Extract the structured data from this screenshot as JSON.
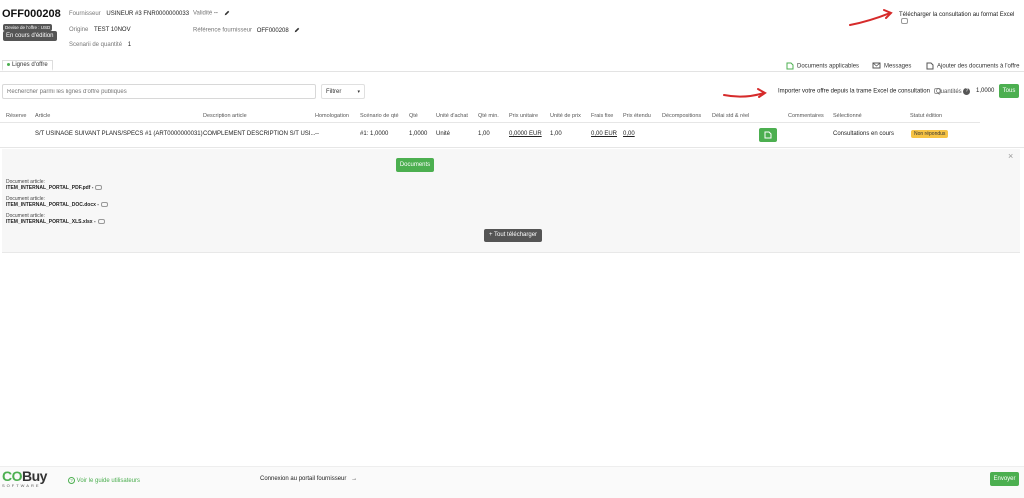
{
  "header": {
    "offer_id": "OFF000208",
    "currency_tag": "Devise de l'offre : USD",
    "status_tag": "En cours d'édition",
    "supplier_label": "Fournisseur",
    "supplier_value": "USINEUR #3 FNR0000000033",
    "origin_label": "Origine",
    "origin_value": "TEST 10NOV",
    "scenario_label": "Scenarii de quantité",
    "scenario_value": "1",
    "validity_label": "Validité",
    "validity_value": "--",
    "supplier_ref_label": "Référence fournisseur",
    "supplier_ref_value": "OFF000208",
    "download_excel": "Télécharger la consultation au format Excel"
  },
  "tabs": {
    "offer_lines": "Lignes d'offre"
  },
  "toolbar": {
    "applicable_docs": "Documents applicables",
    "messages": "Messages",
    "add_docs": "Ajouter des documents à l'offre",
    "search_placeholder": "Rechercher parmi les lignes d'offre publiques",
    "filter_label": "Filtrer",
    "import_excel": "Importer votre offre depuis la trame Excel de consultation",
    "quantities_label": "Quantités",
    "quantities_value": "1,0000",
    "all_button": "Tous"
  },
  "table": {
    "columns": [
      "Réserve",
      "Article",
      "Description article",
      "Homologation",
      "Scénario de qté",
      "Qté",
      "Unité d'achat",
      "Qté min.",
      "Prix unitaire",
      "Unité de prix",
      "Frais fixe",
      "Prix étendu",
      "Décompositions",
      "Délai std & réel",
      "Commentaires",
      "Sélectionné",
      "Statut édition"
    ],
    "row": {
      "article": "S/T USINAGE SUIVANT PLANS/SPECS #1 (ART0000000031)",
      "description": "COMPLEMENT DESCRIPTION S/T USI...",
      "homologation": "--",
      "scenario": "#1: 1,0000",
      "qty": "1,0000",
      "unit": "Unité",
      "min_qty": "1,00",
      "unit_price": "0,0000 EUR",
      "price_unit": "1,00",
      "fixed_fee": "0,00 EUR",
      "extended_price": "0,00",
      "selected": "Consultations en cours",
      "status": "Non répondus"
    }
  },
  "details": {
    "documents_button": "Documents",
    "doc_label": "Document article:",
    "docs": [
      "ITEM_INTERNAL_PORTAL_PDF.pdf -",
      "ITEM_INTERNAL_PORTAL_DOC.docx -",
      "ITEM_INTERNAL_PORTAL_XLS.xlsx -"
    ],
    "download_all": "+ Tout télécharger"
  },
  "footer": {
    "logo_main": "COBuy",
    "logo_sub": "SOFTWARE",
    "guide": "Voir le guide utilisateurs",
    "portal": "Connexion au portail fournisseur",
    "send": "Envoyer"
  },
  "colors": {
    "accent": "#4caf50",
    "arrow": "#d62b2b",
    "badge": "#f6c344"
  }
}
